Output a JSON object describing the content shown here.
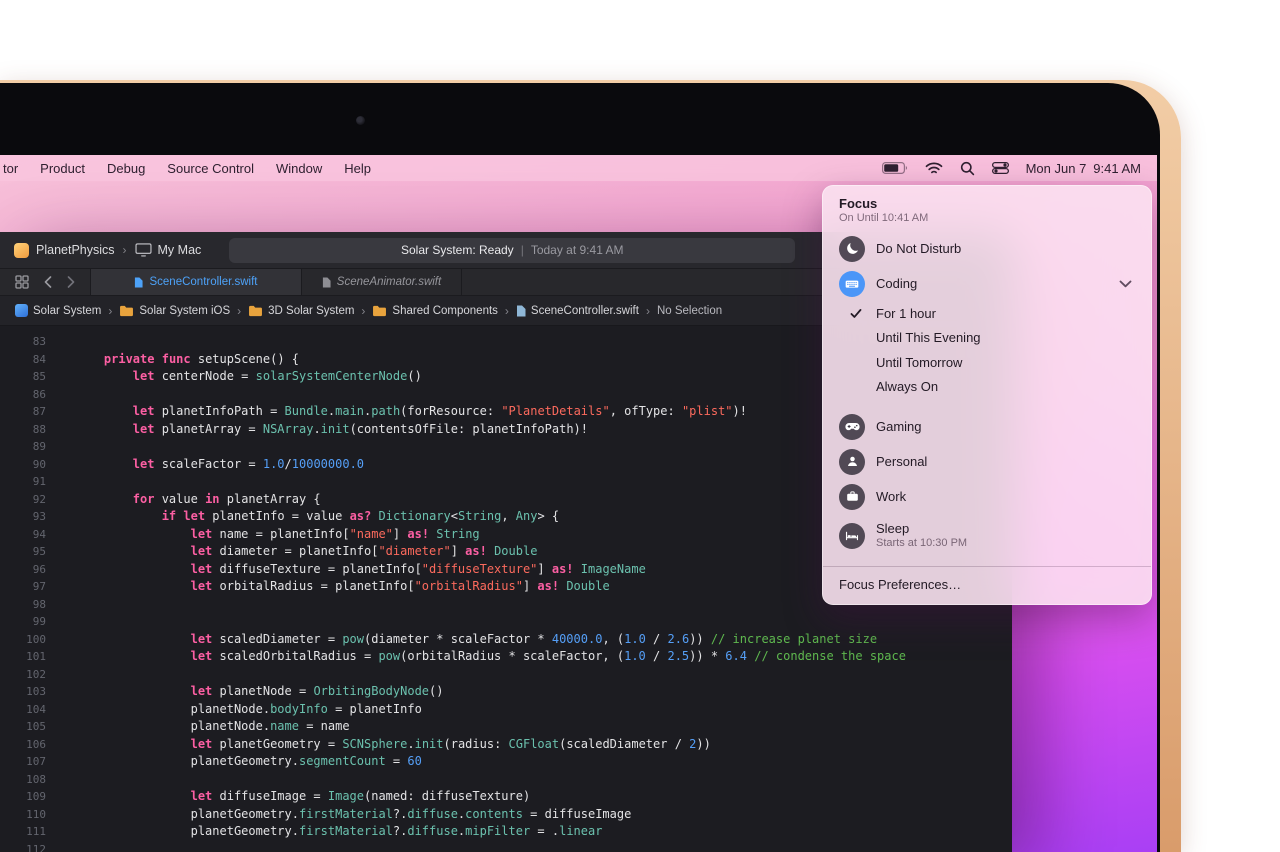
{
  "colors": {
    "accent-blue": "#4da2f8",
    "focus-active-blue": "#4b96f8",
    "folder-orange": "#e8a33d",
    "kw": "#fc5fa3",
    "ty": "#6bc1ae",
    "st": "#fc6a5d",
    "nu": "#559ff7",
    "co": "#5fb94f",
    "pl": "#e3e3e5",
    "editor-bg": "#1c1c21",
    "gold-light": "#f2cda6",
    "gold-dark": "#d99c6b",
    "wallpaper-bottom": "#a93ff4"
  },
  "menubar": {
    "items": [
      "tor",
      "Product",
      "Debug",
      "Source Control",
      "Window",
      "Help"
    ],
    "status_icons": [
      "battery-icon",
      "wifi-icon",
      "search-icon",
      "control-center-icon"
    ],
    "date": "Mon Jun 7",
    "time": "9:41 AM"
  },
  "xcode": {
    "toolbar": {
      "scheme": "PlanetPhysics",
      "chevron": "›",
      "destination": "My Mac",
      "status_primary": "Solar System: Ready",
      "status_divider": "|",
      "status_secondary": "Today at 9:41 AM"
    },
    "tabs": [
      {
        "label": "SceneController.swift",
        "active": true
      },
      {
        "label": "SceneAnimator.swift",
        "active": false
      }
    ],
    "breadcrumb_sep": "›",
    "breadcrumb": [
      {
        "label": "Solar System",
        "icon": "project-icon"
      },
      {
        "label": "Solar System iOS",
        "icon": "folder-icon"
      },
      {
        "label": "3D Solar System",
        "icon": "folder-icon"
      },
      {
        "label": "Shared Components",
        "icon": "folder-icon"
      },
      {
        "label": "SceneController.swift",
        "icon": "file-icon"
      },
      {
        "label": "No Selection",
        "icon": "none"
      }
    ],
    "editor": {
      "lines": [
        {
          "num": 83,
          "tokens": []
        },
        {
          "num": 84,
          "tokens": [
            [
              "p",
              "    "
            ],
            [
              "k",
              "private"
            ],
            [
              "p",
              " "
            ],
            [
              "k",
              "func"
            ],
            [
              "p",
              " setupScene() {"
            ]
          ]
        },
        {
          "num": 85,
          "tokens": [
            [
              "p",
              "        "
            ],
            [
              "k",
              "let"
            ],
            [
              "p",
              " centerNode = "
            ],
            [
              "t",
              "solarSystemCenterNode"
            ],
            [
              "p",
              "()"
            ]
          ]
        },
        {
          "num": 86,
          "tokens": []
        },
        {
          "num": 87,
          "tokens": [
            [
              "p",
              "        "
            ],
            [
              "k",
              "let"
            ],
            [
              "p",
              " planetInfoPath = "
            ],
            [
              "t",
              "Bundle"
            ],
            [
              "p",
              "."
            ],
            [
              "t",
              "main"
            ],
            [
              "p",
              "."
            ],
            [
              "t",
              "path"
            ],
            [
              "p",
              "(forResource: "
            ],
            [
              "s",
              "\"PlanetDetails\""
            ],
            [
              "p",
              ", ofType: "
            ],
            [
              "s",
              "\"plist\""
            ],
            [
              "p",
              ")!"
            ]
          ]
        },
        {
          "num": 88,
          "tokens": [
            [
              "p",
              "        "
            ],
            [
              "k",
              "let"
            ],
            [
              "p",
              " planetArray = "
            ],
            [
              "t",
              "NSArray"
            ],
            [
              "p",
              "."
            ],
            [
              "t",
              "init"
            ],
            [
              "p",
              "(contentsOfFile: planetInfoPath)!"
            ]
          ]
        },
        {
          "num": 89,
          "tokens": []
        },
        {
          "num": 90,
          "tokens": [
            [
              "p",
              "        "
            ],
            [
              "k",
              "let"
            ],
            [
              "p",
              " scaleFactor = "
            ],
            [
              "n",
              "1.0"
            ],
            [
              "p",
              "/"
            ],
            [
              "n",
              "10000000.0"
            ]
          ]
        },
        {
          "num": 91,
          "tokens": []
        },
        {
          "num": 92,
          "tokens": [
            [
              "p",
              "        "
            ],
            [
              "k",
              "for"
            ],
            [
              "p",
              " value "
            ],
            [
              "k",
              "in"
            ],
            [
              "p",
              " planetArray {"
            ]
          ]
        },
        {
          "num": 93,
          "tokens": [
            [
              "p",
              "            "
            ],
            [
              "k",
              "if"
            ],
            [
              "p",
              " "
            ],
            [
              "k",
              "let"
            ],
            [
              "p",
              " planetInfo = value "
            ],
            [
              "k",
              "as?"
            ],
            [
              "p",
              " "
            ],
            [
              "t",
              "Dictionary"
            ],
            [
              "p",
              "<"
            ],
            [
              "t",
              "String"
            ],
            [
              "p",
              ", "
            ],
            [
              "t",
              "Any"
            ],
            [
              "p",
              "> {"
            ]
          ]
        },
        {
          "num": 94,
          "tokens": [
            [
              "p",
              "                "
            ],
            [
              "k",
              "let"
            ],
            [
              "p",
              " name = planetInfo["
            ],
            [
              "s",
              "\"name\""
            ],
            [
              "p",
              "] "
            ],
            [
              "k",
              "as!"
            ],
            [
              "p",
              " "
            ],
            [
              "t",
              "String"
            ]
          ]
        },
        {
          "num": 95,
          "tokens": [
            [
              "p",
              "                "
            ],
            [
              "k",
              "let"
            ],
            [
              "p",
              " diameter = planetInfo["
            ],
            [
              "s",
              "\"diameter\""
            ],
            [
              "p",
              "] "
            ],
            [
              "k",
              "as!"
            ],
            [
              "p",
              " "
            ],
            [
              "t",
              "Double"
            ]
          ]
        },
        {
          "num": 96,
          "tokens": [
            [
              "p",
              "                "
            ],
            [
              "k",
              "let"
            ],
            [
              "p",
              " diffuseTexture = planetInfo["
            ],
            [
              "s",
              "\"diffuseTexture\""
            ],
            [
              "p",
              "] "
            ],
            [
              "k",
              "as!"
            ],
            [
              "p",
              " "
            ],
            [
              "t",
              "ImageName"
            ]
          ]
        },
        {
          "num": 97,
          "tokens": [
            [
              "p",
              "                "
            ],
            [
              "k",
              "let"
            ],
            [
              "p",
              " orbitalRadius = planetInfo["
            ],
            [
              "s",
              "\"orbitalRadius\""
            ],
            [
              "p",
              "] "
            ],
            [
              "k",
              "as!"
            ],
            [
              "p",
              " "
            ],
            [
              "t",
              "Double"
            ]
          ]
        },
        {
          "num": 98,
          "tokens": []
        },
        {
          "num": 99,
          "tokens": []
        },
        {
          "num": 100,
          "tokens": [
            [
              "p",
              "                "
            ],
            [
              "k",
              "let"
            ],
            [
              "p",
              " scaledDiameter = "
            ],
            [
              "t",
              "pow"
            ],
            [
              "p",
              "(diameter * scaleFactor * "
            ],
            [
              "n",
              "40000.0"
            ],
            [
              "p",
              ", ("
            ],
            [
              "n",
              "1.0"
            ],
            [
              "p",
              " / "
            ],
            [
              "n",
              "2.6"
            ],
            [
              "p",
              ")) "
            ],
            [
              "c",
              "// increase planet size"
            ]
          ]
        },
        {
          "num": 101,
          "tokens": [
            [
              "p",
              "                "
            ],
            [
              "k",
              "let"
            ],
            [
              "p",
              " scaledOrbitalRadius = "
            ],
            [
              "t",
              "pow"
            ],
            [
              "p",
              "(orbitalRadius * scaleFactor, ("
            ],
            [
              "n",
              "1.0"
            ],
            [
              "p",
              " / "
            ],
            [
              "n",
              "2.5"
            ],
            [
              "p",
              ")) * "
            ],
            [
              "n",
              "6.4"
            ],
            [
              "p",
              " "
            ],
            [
              "c",
              "// condense the space"
            ]
          ]
        },
        {
          "num": 102,
          "tokens": []
        },
        {
          "num": 103,
          "tokens": [
            [
              "p",
              "                "
            ],
            [
              "k",
              "let"
            ],
            [
              "p",
              " planetNode = "
            ],
            [
              "t",
              "OrbitingBodyNode"
            ],
            [
              "p",
              "()"
            ]
          ]
        },
        {
          "num": 104,
          "tokens": [
            [
              "p",
              "                planetNode."
            ],
            [
              "t",
              "bodyInfo"
            ],
            [
              "p",
              " = planetInfo"
            ]
          ]
        },
        {
          "num": 105,
          "tokens": [
            [
              "p",
              "                planetNode."
            ],
            [
              "t",
              "name"
            ],
            [
              "p",
              " = name"
            ]
          ]
        },
        {
          "num": 106,
          "tokens": [
            [
              "p",
              "                "
            ],
            [
              "k",
              "let"
            ],
            [
              "p",
              " planetGeometry = "
            ],
            [
              "t",
              "SCNSphere"
            ],
            [
              "p",
              "."
            ],
            [
              "t",
              "init"
            ],
            [
              "p",
              "(radius: "
            ],
            [
              "t",
              "CGFloat"
            ],
            [
              "p",
              "(scaledDiameter / "
            ],
            [
              "n",
              "2"
            ],
            [
              "p",
              "))"
            ]
          ]
        },
        {
          "num": 107,
          "tokens": [
            [
              "p",
              "                planetGeometry."
            ],
            [
              "t",
              "segmentCount"
            ],
            [
              "p",
              " = "
            ],
            [
              "n",
              "60"
            ]
          ]
        },
        {
          "num": 108,
          "tokens": []
        },
        {
          "num": 109,
          "tokens": [
            [
              "p",
              "                "
            ],
            [
              "k",
              "let"
            ],
            [
              "p",
              " diffuseImage = "
            ],
            [
              "t",
              "Image"
            ],
            [
              "p",
              "(named: diffuseTexture)"
            ]
          ]
        },
        {
          "num": 110,
          "tokens": [
            [
              "p",
              "                planetGeometry."
            ],
            [
              "t",
              "firstMaterial"
            ],
            [
              "p",
              "?."
            ],
            [
              "t",
              "diffuse"
            ],
            [
              "p",
              "."
            ],
            [
              "t",
              "contents"
            ],
            [
              "p",
              " = diffuseImage"
            ]
          ]
        },
        {
          "num": 111,
          "tokens": [
            [
              "p",
              "                planetGeometry."
            ],
            [
              "t",
              "firstMaterial"
            ],
            [
              "p",
              "?."
            ],
            [
              "t",
              "diffuse"
            ],
            [
              "p",
              "."
            ],
            [
              "t",
              "mipFilter"
            ],
            [
              "p",
              " = ."
            ],
            [
              "t",
              "linear"
            ]
          ]
        },
        {
          "num": 112,
          "tokens": []
        }
      ]
    }
  },
  "focus": {
    "title": "Focus",
    "subtitle": "On Until 10:41 AM",
    "modes": [
      {
        "label": "Do Not Disturb",
        "icon": "moon-icon"
      },
      {
        "label": "Coding",
        "icon": "keyboard-icon",
        "active": true,
        "expanded": true,
        "options": [
          {
            "label": "For 1 hour",
            "checked": true
          },
          {
            "label": "Until This Evening",
            "checked": false
          },
          {
            "label": "Until Tomorrow",
            "checked": false
          },
          {
            "label": "Always On",
            "checked": false
          }
        ]
      },
      {
        "label": "Gaming",
        "icon": "game-controller-icon"
      },
      {
        "label": "Personal",
        "icon": "person-icon"
      },
      {
        "label": "Work",
        "icon": "briefcase-icon"
      },
      {
        "label": "Sleep",
        "icon": "bed-icon",
        "subtitle": "Starts at 10:30 PM"
      }
    ],
    "footer": "Focus Preferences…"
  }
}
